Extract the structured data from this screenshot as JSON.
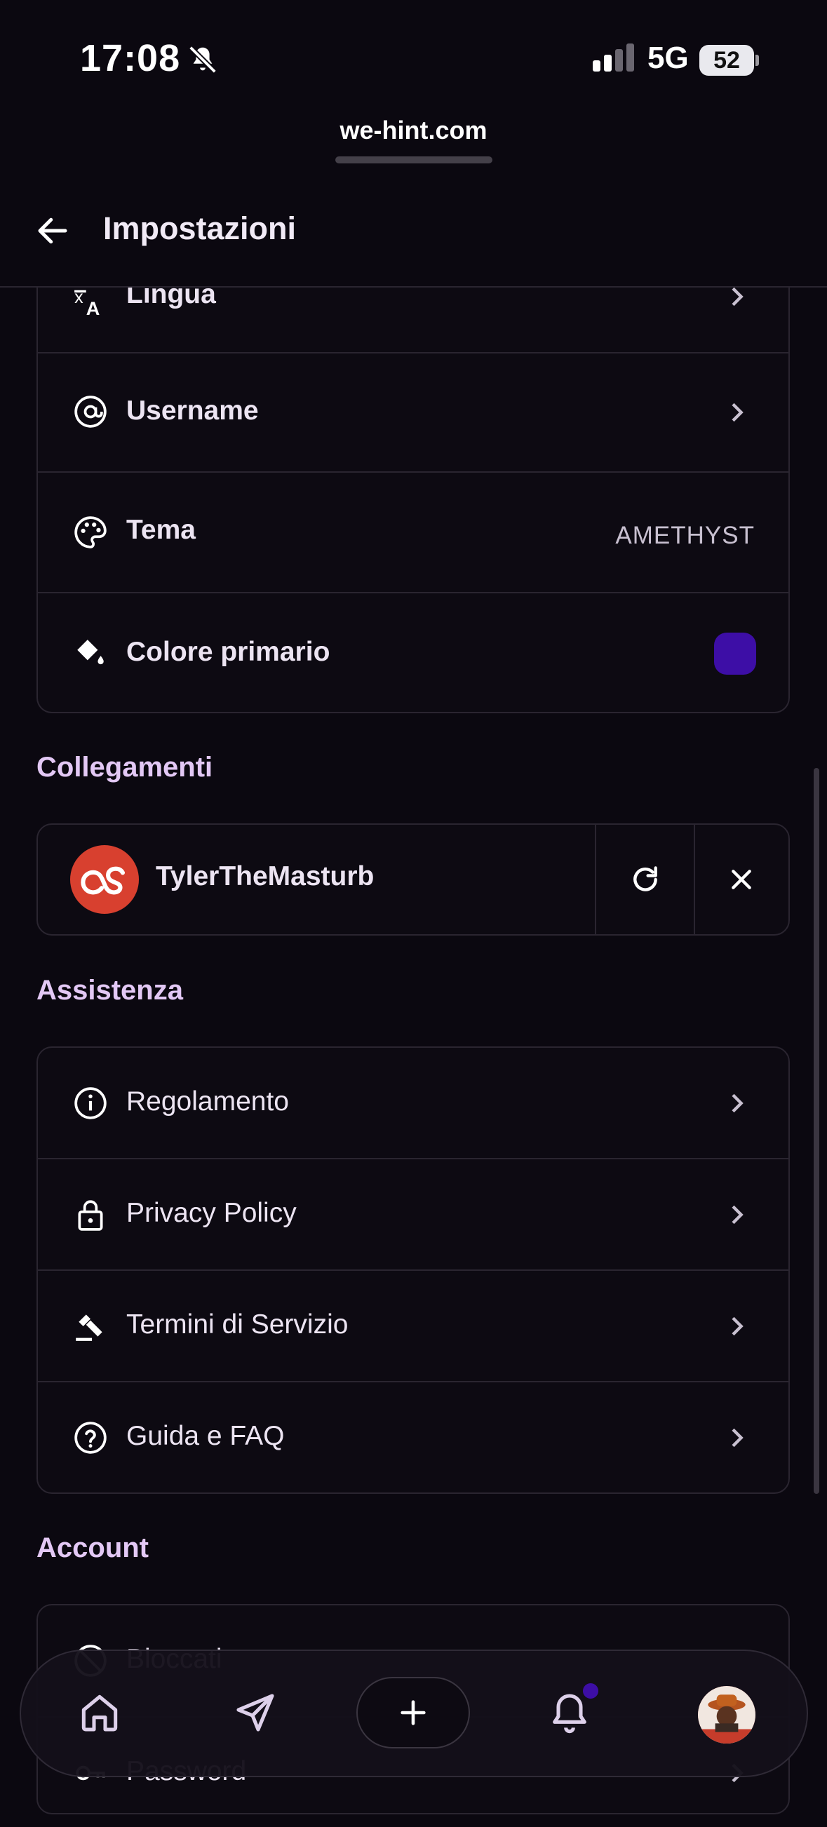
{
  "status_bar": {
    "time": "17:08",
    "network": "5G",
    "battery": "52",
    "url": "we-hint.com"
  },
  "header": {
    "title": "Impostazioni"
  },
  "general": {
    "items": [
      {
        "label": "Lingua",
        "icon": "translate-icon"
      },
      {
        "label": "Username",
        "icon": "at-icon"
      },
      {
        "label": "Tema",
        "icon": "palette-icon",
        "value": "AMETHYST"
      },
      {
        "label": "Colore primario",
        "icon": "paint-bucket-icon",
        "swatch_color": "#3d0ea6"
      }
    ]
  },
  "links": {
    "title": "Collegamenti",
    "account": {
      "name": "TylerTheMasturb",
      "service_icon": "lastfm-icon",
      "brand_color": "#d8402f"
    }
  },
  "support": {
    "title": "Assistenza",
    "items": [
      {
        "label": "Regolamento",
        "icon": "info-icon"
      },
      {
        "label": "Privacy Policy",
        "icon": "lock-icon"
      },
      {
        "label": "Termini di Servizio",
        "icon": "gavel-icon"
      },
      {
        "label": "Guida e FAQ",
        "icon": "help-icon"
      }
    ]
  },
  "account": {
    "title": "Account",
    "items": [
      {
        "label": "Bloccati",
        "icon": "block-icon"
      },
      {
        "label": "Password",
        "icon": "key-icon"
      }
    ]
  },
  "bottom_nav": {
    "items": [
      "home-icon",
      "send-icon",
      "plus-icon",
      "bell-icon",
      "avatar"
    ],
    "notification_dot_color": "#3d0ea6"
  },
  "colors": {
    "background": "#0b0810",
    "card_border": "#2a2530",
    "section_title": "#e3c8f5",
    "accent": "#3d0ea6"
  }
}
